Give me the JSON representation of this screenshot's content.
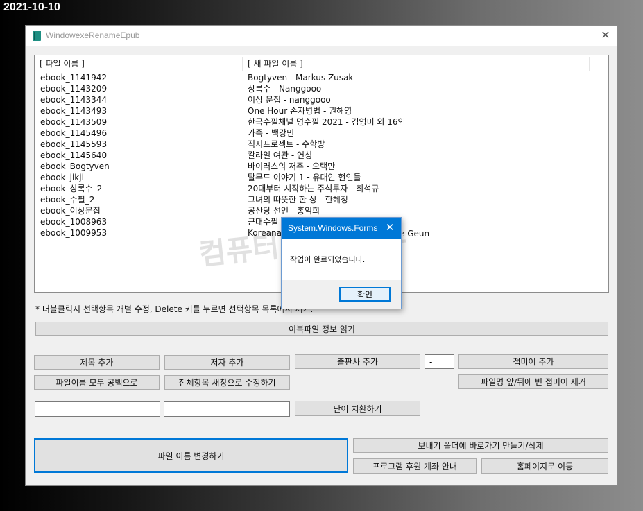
{
  "date_stamp": "2021-10-10",
  "window": {
    "title": "WindowexeRenameEpub",
    "close_glyph": "✕"
  },
  "list": {
    "headers": [
      "[ 파일 이름 ]",
      "[ 새 파일 이름 ]"
    ],
    "rows": [
      [
        "ebook_1141942",
        "Bogtyven - Markus Zusak"
      ],
      [
        "ebook_1143209",
        "상록수 - Nanggooo"
      ],
      [
        "ebook_1143344",
        "이상 문집 - nanggooo"
      ],
      [
        "ebook_1143493",
        "One Hour 손자병법 - 권해영"
      ],
      [
        "ebook_1143509",
        "한국수필채널 명수필 2021 - 김영미 외 16인"
      ],
      [
        "ebook_1145496",
        "가족 - 백강민"
      ],
      [
        "ebook_1145593",
        "직지프로젝트 - 수학방"
      ],
      [
        "ebook_1145640",
        "칼라일 여관 - 연성"
      ],
      [
        "ebook_Bogtyven",
        "바이러스의 저주 - 오택만"
      ],
      [
        "ebook_jikji",
        "탈무드 이야기 1 - 유대인 현인들"
      ],
      [
        "ebook_상록수_2",
        "20대부터 시작하는 주식투자  - 최석규"
      ],
      [
        "ebook_수필_2",
        "그녀의 따뜻한 한 상 - 한혜정"
      ],
      [
        "ebook_이상문집",
        "공산당 선언 - 홍익희"
      ],
      [
        "ebook_1008963",
        "근대수필"
      ],
      [
        "ebook_1009953",
        "Koreana"
      ]
    ],
    "partial_text": "e Geun"
  },
  "watermark": "컴퓨터 관련 정보",
  "hint": "* 더블클릭시 선택항목 개별 수정, Delete 키를 누르면 선택항목 목록에서 제거.",
  "buttons": {
    "read_ebook": "이북파일 정보 읽기",
    "add_title": "제목 추가",
    "add_author": "저자 추가",
    "add_publisher": "출판사 추가",
    "separator_value": "-",
    "add_suffix": "접미어 추가",
    "blank_names": "파일이름 모두 공백으로",
    "edit_all_new_window": "전체항목 새창으로 수정하기",
    "remove_blank_affix": "파일명 앞/뒤에 빈 접미어 제거",
    "replace_word": "단어 치환하기",
    "rename_files": "파일 이름 변경하기",
    "sendto_shortcut": "보내기 폴더에 바로가기 만들기/삭제",
    "donation_info": "프로그램 후원 계좌 안내",
    "go_homepage": "홈페이지로 이동"
  },
  "inputs": {
    "find_value": "",
    "replace_value": ""
  },
  "dialog": {
    "title": "System.Windows.Forms",
    "close_glyph": "✕",
    "message": "작업이 완료되었습니다.",
    "ok_label": "확인"
  },
  "colors": {
    "accent": "#0078d7",
    "app_icon": "#1e8f83"
  }
}
